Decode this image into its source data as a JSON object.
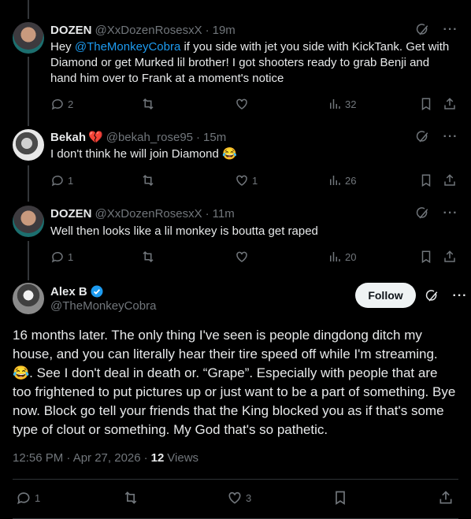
{
  "replies": [
    {
      "name": "DOZEN",
      "handle": "@XxDozenRosesxX",
      "time": "19m",
      "text_before": "Hey ",
      "mention": "@TheMonkeyCobra",
      "text_after": " if you side with jet you side with KickTank. Get with Diamond or get Murked lil brother! I got shooters ready to grab Benji and hand him over to Frank at a moment's notice",
      "replies": "2",
      "reposts": "",
      "likes": "",
      "views": "32"
    },
    {
      "name": "Bekah",
      "name_emoji": "💔",
      "handle": "@bekah_rose95",
      "time": "15m",
      "text": "I don't think he will join Diamond 😂",
      "replies": "1",
      "reposts": "",
      "likes": "1",
      "views": "26"
    },
    {
      "name": "DOZEN",
      "handle": "@XxDozenRosesxX",
      "time": "11m",
      "text": "Well then looks like a lil monkey is boutta get raped",
      "replies": "1",
      "reposts": "",
      "likes": "",
      "views": "20"
    }
  ],
  "main": {
    "name": "Alex B",
    "handle": "@TheMonkeyCobra",
    "follow_label": "Follow",
    "text": "16 months later.  The only thing I've seen is people dingdong ditch my house, and you can literally hear their tire speed off while I'm streaming. 😂.  See I don't deal in death or. “Grape”. Especially with people that are too frightened to put pictures up or just want to be a part of something.  Bye now.  Block go tell your friends that the King blocked you as if that's some type of clout or something.   My God that's so pathetic.",
    "timestamp": "12:56 PM · Apr 27, 2026",
    "views_count": "12",
    "views_label": "Views",
    "replies": "1",
    "reposts": "",
    "likes": "3"
  },
  "colors": {
    "background": "#000000",
    "text": "#e7e9ea",
    "muted": "#71767b",
    "link": "#1d9bf0",
    "verified": "#1d9bf0",
    "divider": "#2f3336"
  }
}
